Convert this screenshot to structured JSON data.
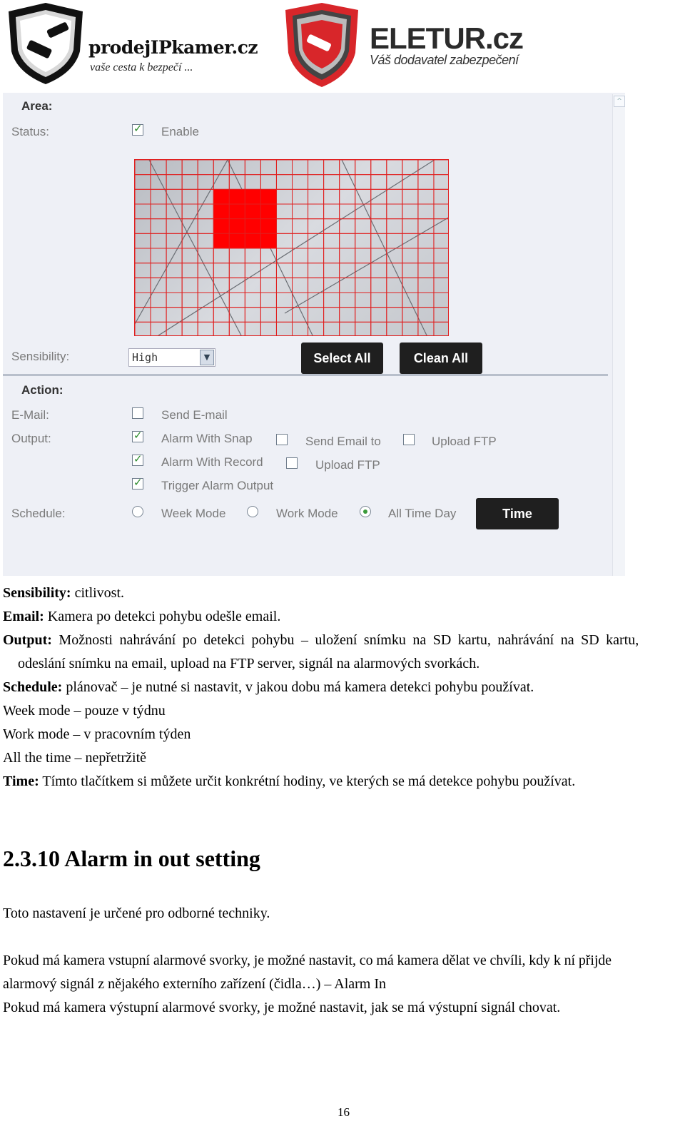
{
  "logos": {
    "left": {
      "name": "prodejIPkamer.cz",
      "tagline": "vaše cesta k bezpečí ..."
    },
    "right": {
      "name": "ELETUR.cz",
      "tagline": "Váš dodavatel zabezpečení"
    }
  },
  "panel": {
    "area_heading": "Area:",
    "status_label": "Status:",
    "status_enable": {
      "label": "Enable",
      "checked": true
    },
    "grid": {
      "columns": 20,
      "rows": 12,
      "selected_cells": {
        "cols": [
          5,
          6,
          7,
          8
        ],
        "rows": [
          2,
          3,
          4,
          5
        ]
      },
      "selected_color": "#ff0000",
      "grid_color": "#e02020"
    },
    "sensibility_label": "Sensibility:",
    "sensibility_value": "High",
    "select_all": "Select All",
    "clean_all": "Clean All",
    "action_heading": "Action:",
    "email_label": "E-Mail:",
    "send_email": {
      "label": "Send E-mail",
      "checked": false
    },
    "output_label": "Output:",
    "alarm_snap": {
      "label": "Alarm With Snap",
      "checked": true
    },
    "send_email_to": {
      "label": "Send Email to",
      "checked": false
    },
    "upload_ftp1": {
      "label": "Upload FTP",
      "checked": false
    },
    "alarm_record": {
      "label": "Alarm With Record",
      "checked": true
    },
    "upload_ftp2": {
      "label": "Upload FTP",
      "checked": false
    },
    "trigger_alarm": {
      "label": "Trigger Alarm Output",
      "checked": true
    },
    "schedule_label": "Schedule:",
    "week_mode": {
      "label": "Week Mode",
      "selected": false
    },
    "work_mode": {
      "label": "Work Mode",
      "selected": false
    },
    "all_time": {
      "label": "All Time Day",
      "selected": true
    },
    "time_button": "Time"
  },
  "doc": {
    "l1": {
      "b": "Sensibility:",
      "t": " citlivost."
    },
    "l2": {
      "b": "Email:",
      "t": " Kamera po detekci pohybu odešle email."
    },
    "l3": {
      "b": "Output:",
      "t": " Možnosti nahrávání po detekci pohybu – uložení snímku na SD kartu, nahrávání na SD kartu,"
    },
    "l4": "odeslání snímku na email, upload na FTP server, signál na alarmových svorkách.",
    "l5": {
      "b": "Schedule:",
      "t": " plánovač – je nutné si nastavit, v jakou dobu má kamera detekci pohybu používat."
    },
    "l6": "Week mode – pouze v týdnu",
    "l7": "Work mode – v pracovním týden",
    "l8": "All the time – nepřetržitě",
    "l9": {
      "b": "Time:",
      "t": " Tímto tlačítkem si můžete určit konkrétní hodiny, ve kterých se má detekce pohybu používat."
    },
    "heading": "2.3.10 Alarm in out setting",
    "p1": "Toto nastavení je určené pro odborné techniky.",
    "p2a": "Pokud má kamera vstupní alarmové svorky, je možné nastavit, co má kamera dělat ve chvíli, kdy k ní přijde",
    "p2b": "alarmový signál z nějakého externího zařízení (čidla…) – Alarm In",
    "p3": "Pokud má kamera výstupní alarmové svorky, je možné nastavit, jak se má výstupní signál chovat.",
    "page_number": "16"
  }
}
